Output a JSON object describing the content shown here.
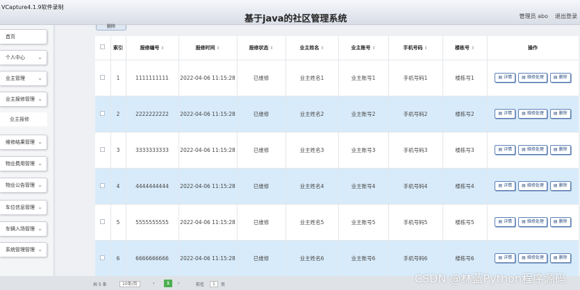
{
  "recorder": {
    "label": "VCapture4.1.9软件录制"
  },
  "header": {
    "title": "基于java的社区管理系统",
    "user": "管理员 abo",
    "logout": "退出登录"
  },
  "toolbar": {
    "top_button": "删除"
  },
  "sidebar": {
    "items": [
      {
        "label": "首页",
        "has_chevron": false
      },
      {
        "label": "个人中心",
        "has_chevron": true
      },
      {
        "label": "业主管理",
        "has_chevron": true
      },
      {
        "label": "业主报修管理",
        "has_chevron": true
      },
      {
        "label": "维修结果管理",
        "has_chevron": true
      },
      {
        "label": "物业费用管理",
        "has_chevron": true
      },
      {
        "label": "物业公告管理",
        "has_chevron": true
      },
      {
        "label": "车位信息管理",
        "has_chevron": true
      },
      {
        "label": "车辆入场管理",
        "has_chevron": true
      },
      {
        "label": "系统管理管理",
        "has_chevron": true
      }
    ],
    "subitem": "业主报修"
  },
  "table": {
    "columns": [
      "索引",
      "报修编号",
      "报修时间",
      "报修状态",
      "业主姓名",
      "业主账号",
      "手机号码",
      "楼栋号",
      "操作"
    ],
    "rows": [
      {
        "index": "1",
        "code": "1111111111",
        "time": "2022-04-06 11:15:28",
        "status": "已维修",
        "name": "业主姓名1",
        "account": "业主账号1",
        "phone": "手机号码1",
        "building": "楼栋号1"
      },
      {
        "index": "2",
        "code": "2222222222",
        "time": "2022-04-06 11:15:28",
        "status": "已维修",
        "name": "业主姓名2",
        "account": "业主账号2",
        "phone": "手机号码2",
        "building": "楼栋号2"
      },
      {
        "index": "3",
        "code": "3333333333",
        "time": "2022-04-06 11:15:28",
        "status": "已维修",
        "name": "业主姓名3",
        "account": "业主账号3",
        "phone": "手机号码3",
        "building": "楼栋号3"
      },
      {
        "index": "4",
        "code": "4444444444",
        "time": "2022-04-06 11:15:28",
        "status": "已维修",
        "name": "业主姓名4",
        "account": "业主账号4",
        "phone": "手机号码4",
        "building": "楼栋号4"
      },
      {
        "index": "5",
        "code": "5555555555",
        "time": "2022-04-06 11:15:28",
        "status": "已维修",
        "name": "业主姓名5",
        "account": "业主账号5",
        "phone": "手机号码5",
        "building": "楼栋号5"
      },
      {
        "index": "6",
        "code": "6666666666",
        "time": "2022-04-06 11:15:28",
        "status": "已维修",
        "name": "业主姓名6",
        "account": "业主账号6",
        "phone": "手机号码6",
        "building": "楼栋号6"
      }
    ],
    "actions": {
      "detail": "详情",
      "repair": "维修处理",
      "delete": "删除"
    }
  },
  "pagination": {
    "total": "共 5 条",
    "page_size": "10条/页",
    "current_page": "1",
    "goto_label": "前往",
    "goto_value": "1",
    "page_suffix": "页"
  },
  "watermark": {
    "text": "CSDN @林蓝Python程序源码"
  },
  "colors": {
    "stripe": "#d8ebfa",
    "button_border": "#5a7fb5",
    "current_page": "#4caf50"
  }
}
